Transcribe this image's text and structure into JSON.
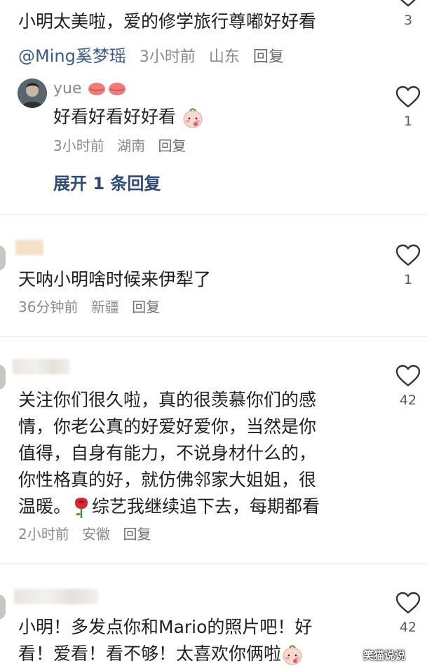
{
  "comments": [
    {
      "text": "小明太美啦，爱的修学旅行尊嘟好好看",
      "mention": "@Ming奚梦瑶",
      "time": "3小时前",
      "location": "山东",
      "reply": "回复",
      "likes": "3",
      "sub_reply": {
        "author": "yue",
        "text": "好看好看好好看",
        "time": "3小时前",
        "location": "湖南",
        "reply": "回复",
        "likes": "1"
      },
      "expand": "展开 1 条回复"
    },
    {
      "text": "天呐小明啥时候来伊犁了",
      "time": "36分钟前",
      "location": "新疆",
      "reply": "回复",
      "likes": "1"
    },
    {
      "lines": [
        "关注你们很久啦，真的很羡慕你们的感",
        "情，你老公真的好爱好爱你，当然是你",
        "值得，自身有能力，不说身材什么的，",
        "你性格真的好，就仿佛邻家大姐姐，很",
        "温暖。",
        "综艺我继续追下去，每期都看"
      ],
      "time": "2小时前",
      "location": "安徽",
      "reply": "回复",
      "likes": "42"
    },
    {
      "lines": [
        "小明！多发点你和Mario的照片吧！好",
        "看！爱看！看不够！太喜欢你俩啦"
      ],
      "likes": "42"
    }
  ],
  "watermark": "笑猫说说",
  "icons": {
    "like": "heart-outline-icon",
    "emoji": "shy-face-emoji-icon",
    "rose": "rose-emoji-icon",
    "lips": "kiss-lips-icon"
  },
  "colors": {
    "text": "#1f1f1f",
    "meta": "#8a8a8a",
    "mention": "#3b5a86",
    "expand": "#2d4a78"
  }
}
